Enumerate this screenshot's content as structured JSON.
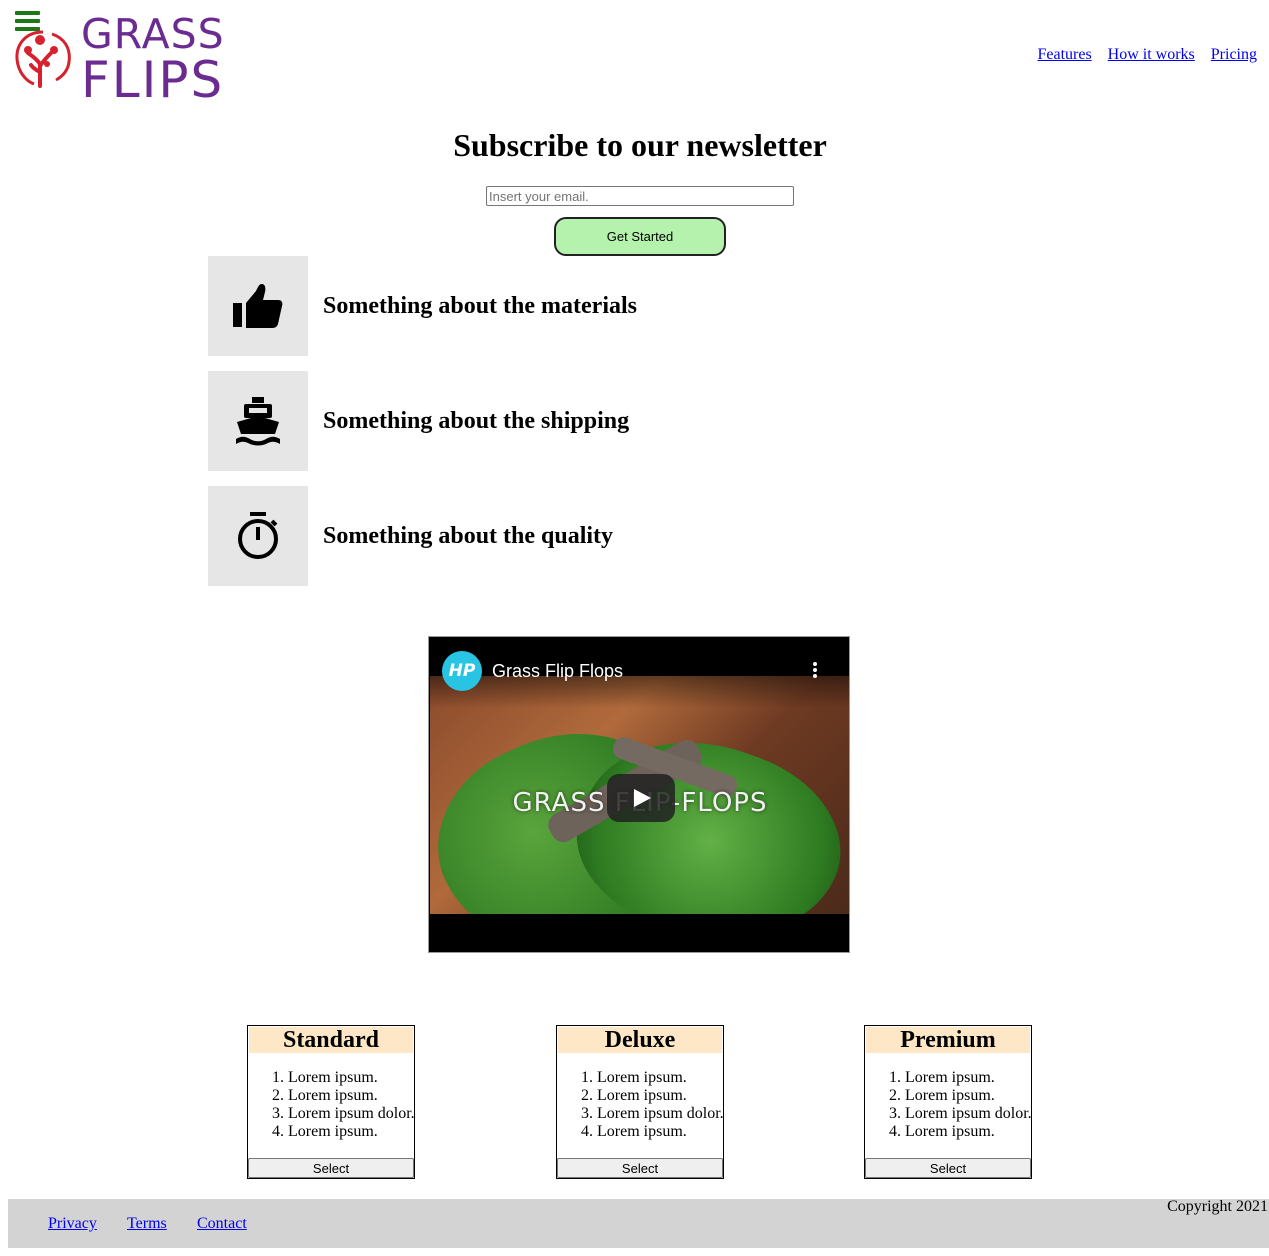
{
  "brand": {
    "line1": "GRASS",
    "line2": "FLIPS"
  },
  "nav": [
    {
      "label": "Features"
    },
    {
      "label": "How it works"
    },
    {
      "label": "Pricing"
    }
  ],
  "newsletter": {
    "title": "Subscribe to our newsletter",
    "placeholder": "Insert your email.",
    "button": "Get Started"
  },
  "features": [
    {
      "icon": "thumbs-up-icon",
      "text": "Something about the materials"
    },
    {
      "icon": "ship-icon",
      "text": "Something about the shipping"
    },
    {
      "icon": "stopwatch-icon",
      "text": "Something about the quality"
    }
  ],
  "video": {
    "channel_badge": "HP",
    "title": "Grass Flip Flops",
    "overlay": "GRASS FLIP-FLOPS"
  },
  "plans": [
    {
      "name": "Standard",
      "items": [
        "Lorem ipsum.",
        "Lorem ipsum.",
        "Lorem ipsum dolor.",
        "Lorem ipsum."
      ],
      "button": "Select"
    },
    {
      "name": "Deluxe",
      "items": [
        "Lorem ipsum.",
        "Lorem ipsum.",
        "Lorem ipsum dolor.",
        "Lorem ipsum."
      ],
      "button": "Select"
    },
    {
      "name": "Premium",
      "items": [
        "Lorem ipsum.",
        "Lorem ipsum.",
        "Lorem ipsum dolor.",
        "Lorem ipsum."
      ],
      "button": "Select"
    }
  ],
  "footer": {
    "links": [
      "Privacy",
      "Terms",
      "Contact"
    ],
    "copyright": "Copyright 2021"
  },
  "colors": {
    "brand_purple": "#6b2c91",
    "logo_red": "#d6222f",
    "cta_green": "#b5f2ae",
    "plan_header": "#fde7c6",
    "footer_bg": "#d3d3d3"
  }
}
